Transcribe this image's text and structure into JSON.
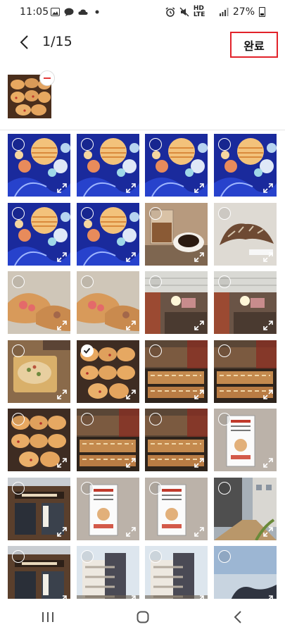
{
  "status": {
    "time": "11:05",
    "signal_label": "HD LTE",
    "battery": "27%"
  },
  "header": {
    "selection_count": "1/15",
    "done_label": "완료"
  },
  "colors": {
    "highlight_border": "#e2222a",
    "remove_icon": "#e23a3a"
  },
  "grid": {
    "columns": 4,
    "rows_visible": 7,
    "checked_index": 13,
    "photos": [
      {
        "subject": "planets"
      },
      {
        "subject": "planets"
      },
      {
        "subject": "planets"
      },
      {
        "subject": "planets"
      },
      {
        "subject": "planets"
      },
      {
        "subject": "planets"
      },
      {
        "subject": "coffee"
      },
      {
        "subject": "croissant"
      },
      {
        "subject": "croissants"
      },
      {
        "subject": "croissants"
      },
      {
        "subject": "bakery interior"
      },
      {
        "subject": "bakery interior"
      },
      {
        "subject": "pizza bread"
      },
      {
        "subject": "buns with faces"
      },
      {
        "subject": "pastry display"
      },
      {
        "subject": "pastry display"
      },
      {
        "subject": "buns with faces"
      },
      {
        "subject": "pastry display"
      },
      {
        "subject": "pastry display"
      },
      {
        "subject": "poster"
      },
      {
        "subject": "storefront"
      },
      {
        "subject": "poster"
      },
      {
        "subject": "poster"
      },
      {
        "subject": "street"
      },
      {
        "subject": "storefront"
      },
      {
        "subject": "building"
      },
      {
        "subject": "building"
      },
      {
        "subject": "sky"
      }
    ]
  }
}
